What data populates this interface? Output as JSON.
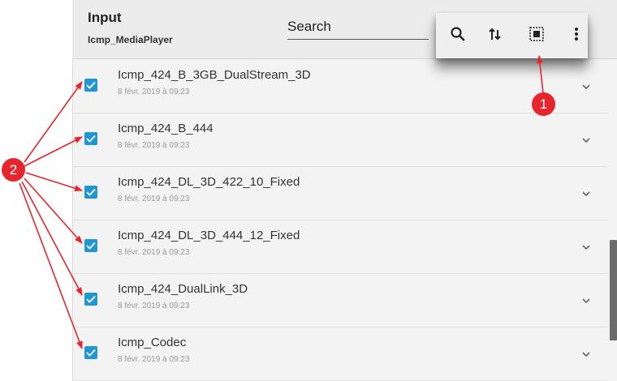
{
  "header": {
    "title": "Input",
    "subtitle": "Icmp_MediaPlayer"
  },
  "search": {
    "placeholder": "Search"
  },
  "toolbar": {
    "icons": [
      "search-icon",
      "sort-icon",
      "select-all-icon",
      "more-vert-icon"
    ]
  },
  "items": [
    {
      "name": "Icmp_424_B_3GB_DualStream_3D",
      "date": "8 févr. 2019 à 09:23",
      "checked": true
    },
    {
      "name": "Icmp_424_B_444",
      "date": "8 févr. 2019 à 09:23",
      "checked": true
    },
    {
      "name": "Icmp_424_DL_3D_422_10_Fixed",
      "date": "8 févr. 2019 à 09:23",
      "checked": true
    },
    {
      "name": "Icmp_424_DL_3D_444_12_Fixed",
      "date": "8 févr. 2019 à 09:23",
      "checked": true
    },
    {
      "name": "Icmp_424_DualLink_3D",
      "date": "8 févr. 2019 à 09:23",
      "checked": true
    },
    {
      "name": "Icmp_Codec",
      "date": "8 févr. 2019 à 09:23",
      "checked": true
    }
  ],
  "callouts": {
    "one": "1",
    "two": "2"
  },
  "colors": {
    "checkbox": "#2196d3",
    "callout": "#e5262c"
  }
}
